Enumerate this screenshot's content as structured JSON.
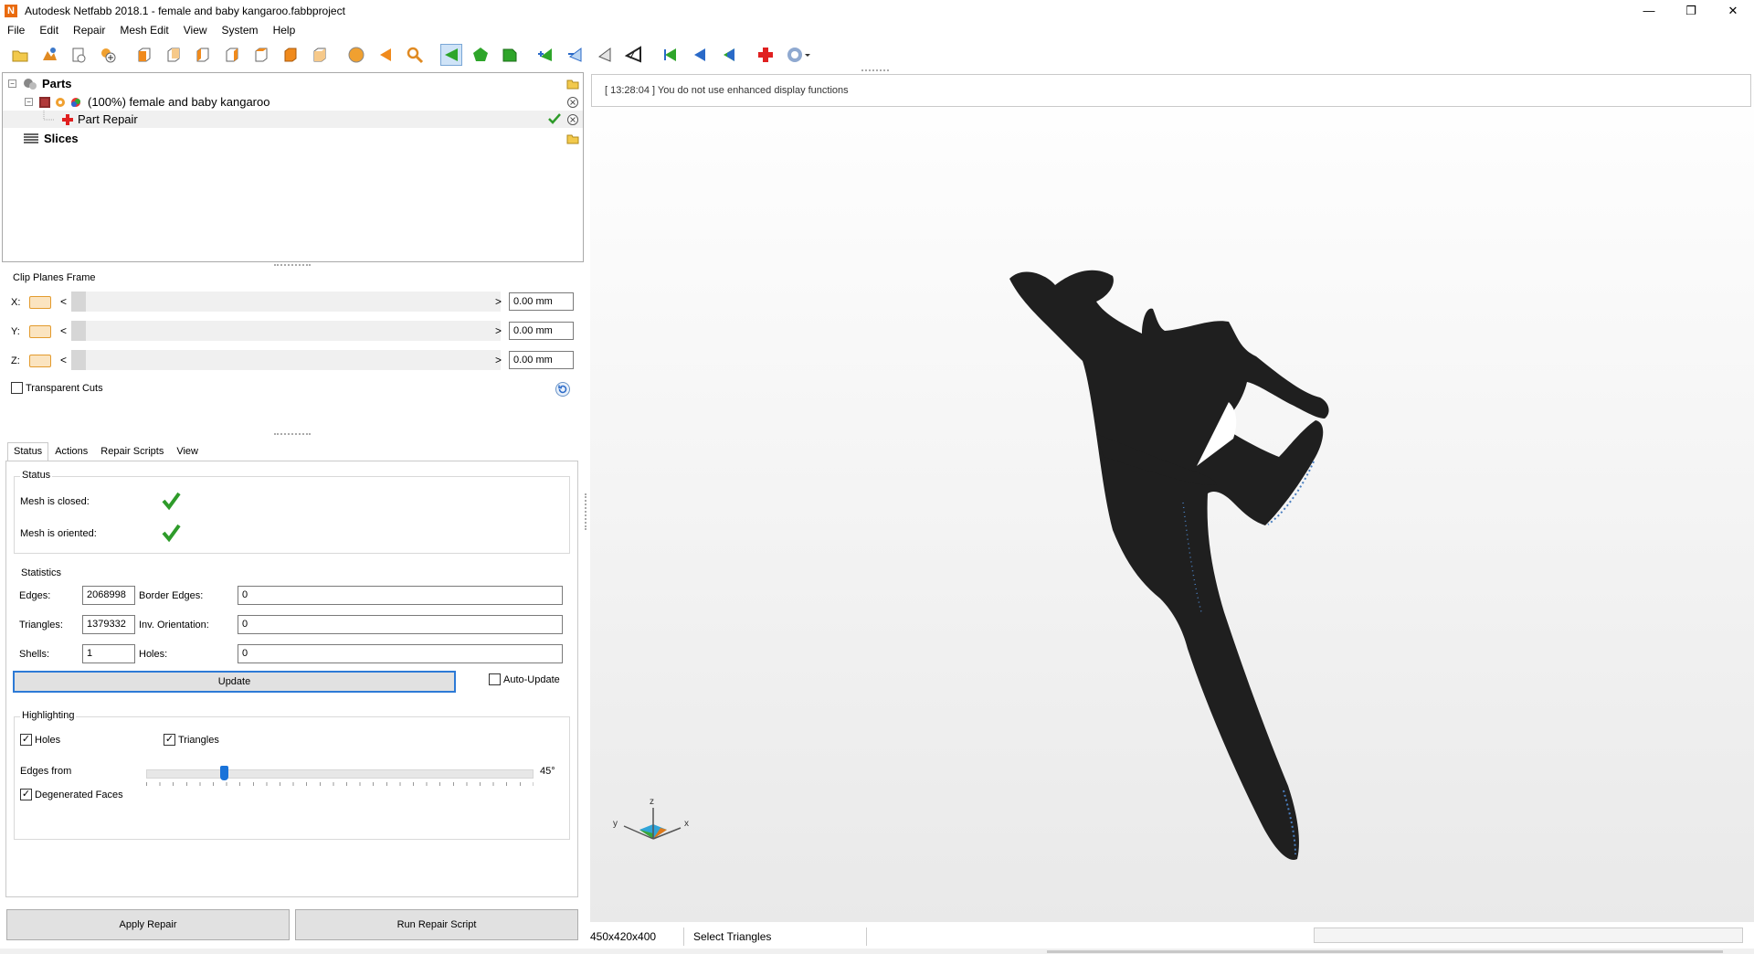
{
  "window": {
    "app_icon_letter": "N",
    "title": "Autodesk Netfabb 2018.1 - female and baby kangaroo.fabbproject",
    "minimize": "—",
    "restore": "❐",
    "close": "✕"
  },
  "menu": [
    "File",
    "Edit",
    "Repair",
    "Mesh Edit",
    "View",
    "System",
    "Help"
  ],
  "tree": {
    "parts_label": "Parts",
    "part_name": "(100%) female and baby kangaroo",
    "repair_label": "Part Repair",
    "slices_label": "Slices",
    "expander_collapse": "−"
  },
  "clip": {
    "frame_title": "Clip Planes Frame",
    "rows": [
      {
        "axis": "X:",
        "value": "0.00 mm"
      },
      {
        "axis": "Y:",
        "value": "0.00 mm"
      },
      {
        "axis": "Z:",
        "value": "0.00 mm"
      }
    ],
    "arrow_left": "<",
    "arrow_right": ">",
    "transparent_cuts": "Transparent Cuts",
    "transparent_cuts_checked": false
  },
  "tabs": [
    "Status",
    "Actions",
    "Repair Scripts",
    "View"
  ],
  "status": {
    "group_title": "Status",
    "mesh_closed": "Mesh is closed:",
    "mesh_oriented": "Mesh is oriented:"
  },
  "statistics": {
    "group_title": "Statistics",
    "edges_label": "Edges:",
    "edges_value": "2068998",
    "border_edges_label": "Border Edges:",
    "border_edges_value": "0",
    "triangles_label": "Triangles:",
    "triangles_value": "1379332",
    "inv_orientation_label": "Inv. Orientation:",
    "inv_orientation_value": "0",
    "shells_label": "Shells:",
    "shells_value": "1",
    "holes_label": "Holes:",
    "holes_value": "0",
    "update_button": "Update",
    "auto_update": "Auto-Update",
    "auto_update_checked": false
  },
  "highlighting": {
    "group_title": "Highlighting",
    "holes": "Holes",
    "holes_checked": true,
    "triangles": "Triangles",
    "triangles_checked": true,
    "edges_from": "Edges from",
    "edges_value": "45°",
    "edges_slider_fraction": 0.2,
    "degenerated_faces": "Degenerated Faces",
    "degenerated_checked": true,
    "check_mark": "✓"
  },
  "buttons": {
    "apply_repair": "Apply Repair",
    "run_repair_script": "Run Repair Script"
  },
  "console": {
    "message": "[ 13:28:04 ] You do not use enhanced display functions"
  },
  "axes": {
    "x": "x",
    "y": "y",
    "z": "z"
  },
  "statusbar": {
    "dimensions": "450x420x400",
    "mode": "Select Triangles"
  },
  "colors": {
    "accent": "#2d7ad6",
    "model": "#1f1f1f",
    "model_highlight": "#4a7fc0",
    "check_green": "#2e9b2a"
  }
}
